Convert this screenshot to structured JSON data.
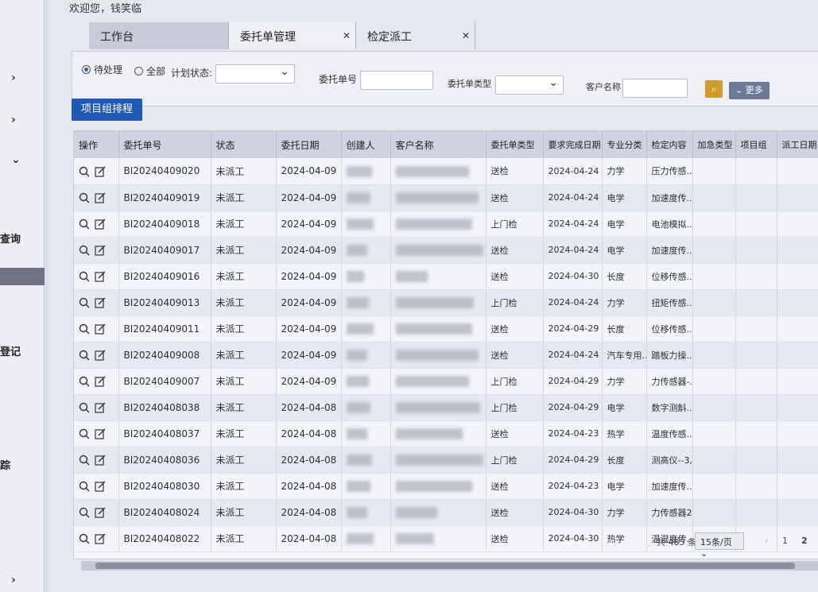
{
  "welcome": "欢迎您，钱笑临",
  "tabs": [
    {
      "label": "工作台",
      "closable": false
    },
    {
      "label": "委托单管理",
      "closable": true
    },
    {
      "label": "检定派工",
      "closable": true
    }
  ],
  "sidebar": {
    "labels": [
      "查询",
      "登记",
      "踪"
    ]
  },
  "filters": {
    "radio_pending": "待处理",
    "radio_all": "全部",
    "plan_status_label": "计划状态:",
    "order_no_label": "委托单号",
    "order_type_label": "委托单类型",
    "customer_label": "客户名称",
    "more_label": "更多"
  },
  "actions": {
    "schedule_button": "项目组排程"
  },
  "table": {
    "headers": [
      "操作",
      "委托单号",
      "状态",
      "委托日期",
      "创建人",
      "客户名称",
      "委托单类型",
      "要求完成日期",
      "专业分类",
      "检定内容",
      "加急类型",
      "项目组",
      "派工日期"
    ],
    "rows": [
      {
        "no": "BI20240409020",
        "status": "未派工",
        "date": "2024-04-09",
        "type": "送检",
        "due": "2024-04-24",
        "cat": "力学",
        "content": "压力传感..."
      },
      {
        "no": "BI20240409019",
        "status": "未派工",
        "date": "2024-04-09",
        "type": "送检",
        "due": "2024-04-24",
        "cat": "电学",
        "content": "加速度传..."
      },
      {
        "no": "BI20240409018",
        "status": "未派工",
        "date": "2024-04-09",
        "type": "上门检",
        "due": "2024-04-24",
        "cat": "电学",
        "content": "电池模拟..."
      },
      {
        "no": "BI20240409017",
        "status": "未派工",
        "date": "2024-04-09",
        "type": "送检",
        "due": "2024-04-24",
        "cat": "电学",
        "content": "加速度传..."
      },
      {
        "no": "BI20240409016",
        "status": "未派工",
        "date": "2024-04-09",
        "type": "送检",
        "due": "2024-04-30",
        "cat": "长度",
        "content": "位移传感..."
      },
      {
        "no": "BI20240409013",
        "status": "未派工",
        "date": "2024-04-09",
        "type": "上门检",
        "due": "2024-04-24",
        "cat": "力学",
        "content": "扭矩传感..."
      },
      {
        "no": "BI20240409011",
        "status": "未派工",
        "date": "2024-04-09",
        "type": "送检",
        "due": "2024-04-29",
        "cat": "长度",
        "content": "位移传感..."
      },
      {
        "no": "BI20240409008",
        "status": "未派工",
        "date": "2024-04-09",
        "type": "送检",
        "due": "2024-04-24",
        "cat": "汽车专用...",
        "content": "踏板力操..."
      },
      {
        "no": "BI20240409007",
        "status": "未派工",
        "date": "2024-04-09",
        "type": "上门检",
        "due": "2024-04-29",
        "cat": "力学",
        "content": "力传感器-..."
      },
      {
        "no": "BI20240408038",
        "status": "未派工",
        "date": "2024-04-08",
        "type": "上门检",
        "due": "2024-04-29",
        "cat": "电学",
        "content": "数字测斛..."
      },
      {
        "no": "BI20240408037",
        "status": "未派工",
        "date": "2024-04-08",
        "type": "送检",
        "due": "2024-04-23",
        "cat": "热学",
        "content": "温度传感..."
      },
      {
        "no": "BI20240408036",
        "status": "未派工",
        "date": "2024-04-08",
        "type": "上门检",
        "due": "2024-04-29",
        "cat": "长度",
        "content": "测高仪--3,..."
      },
      {
        "no": "BI20240408030",
        "status": "未派工",
        "date": "2024-04-08",
        "type": "送检",
        "due": "2024-04-23",
        "cat": "电学",
        "content": "加速度传..."
      },
      {
        "no": "BI20240408024",
        "status": "未派工",
        "date": "2024-04-08",
        "type": "送检",
        "due": "2024-04-30",
        "cat": "力学",
        "content": "力传感器2..."
      },
      {
        "no": "BI20240408022",
        "status": "未派工",
        "date": "2024-04-08",
        "type": "送检",
        "due": "2024-04-30",
        "cat": "热学",
        "content": "温湿度传..."
      }
    ]
  },
  "pagination": {
    "total": "共 485 条",
    "page_size": "15条/页",
    "pages": [
      "1",
      "2"
    ]
  },
  "colors": {
    "primary": "#1f58b5",
    "search": "#d09a2c",
    "more": "#6c7a97"
  }
}
